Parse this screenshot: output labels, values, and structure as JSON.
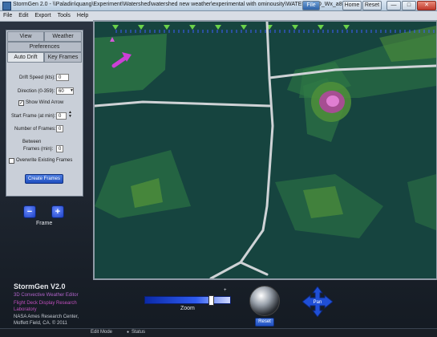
{
  "window": {
    "title": "StormGen 2.0 - \\\\Paladin\\quang\\Experiment\\Watershed\\watershed new weather\\experimental with ominousity\\WATERSHED_Wx_a8.wxt",
    "controls": [
      "File",
      "Home",
      "Reset",
      "—",
      "□",
      "✕"
    ]
  },
  "menu": [
    "File",
    "Edit",
    "Export",
    "Tools",
    "Help"
  ],
  "panel": {
    "tabs_row1": [
      "View",
      "Weather"
    ],
    "tabs_row2": [
      "Preferences"
    ],
    "tabs_row3": [
      "Auto Drift",
      "Key Frames"
    ],
    "drift_speed_label": "Drift Speed (kts):",
    "drift_speed_value": "0",
    "direction_label": "Direction (0-359):",
    "direction_value": "60",
    "show_wind_arrow_label": "Show Wind Arrow",
    "show_wind_arrow_checked": "✓",
    "start_frame_label": "Start Frame (at min):",
    "start_frame_value": "0",
    "num_frames_label": "Number of Frames:",
    "num_frames_value": "0",
    "between_label": "Between",
    "frames_min_label": "Frames (min):",
    "frames_min_value": "0",
    "overwrite_label": "Overwrite Existing Frames",
    "create_button": "Create Frames"
  },
  "frame_nav": {
    "prev": "−",
    "next": "+",
    "label": "Frame"
  },
  "branding": {
    "app_name": "StormGen V2.0",
    "subtitle": "3D Convective Weather Editor",
    "lab_line1": "Flight Deck Display Research",
    "lab_line2": "Laboratory",
    "org_line1": "NASA Ames Research Center,",
    "org_line2": "Moffett Field, CA. © 2011"
  },
  "zoom": {
    "label": "Zoom",
    "max_marker": "+",
    "level": 0.8
  },
  "reset_label": "Reset",
  "pan_label": "Pan",
  "status": {
    "edit_mode": "Edit Mode",
    "status": "Status"
  },
  "colors": {
    "map_bg": "#16443f",
    "storm_light": "#2f7a45",
    "storm_mid": "#4f8f3a",
    "storm_core": "#b0489c",
    "storm_peak": "#e07ed2",
    "road": "#cfd3d6",
    "accent_blue": "#1f4fbf",
    "wind_arrow": "#cc3fd6"
  }
}
